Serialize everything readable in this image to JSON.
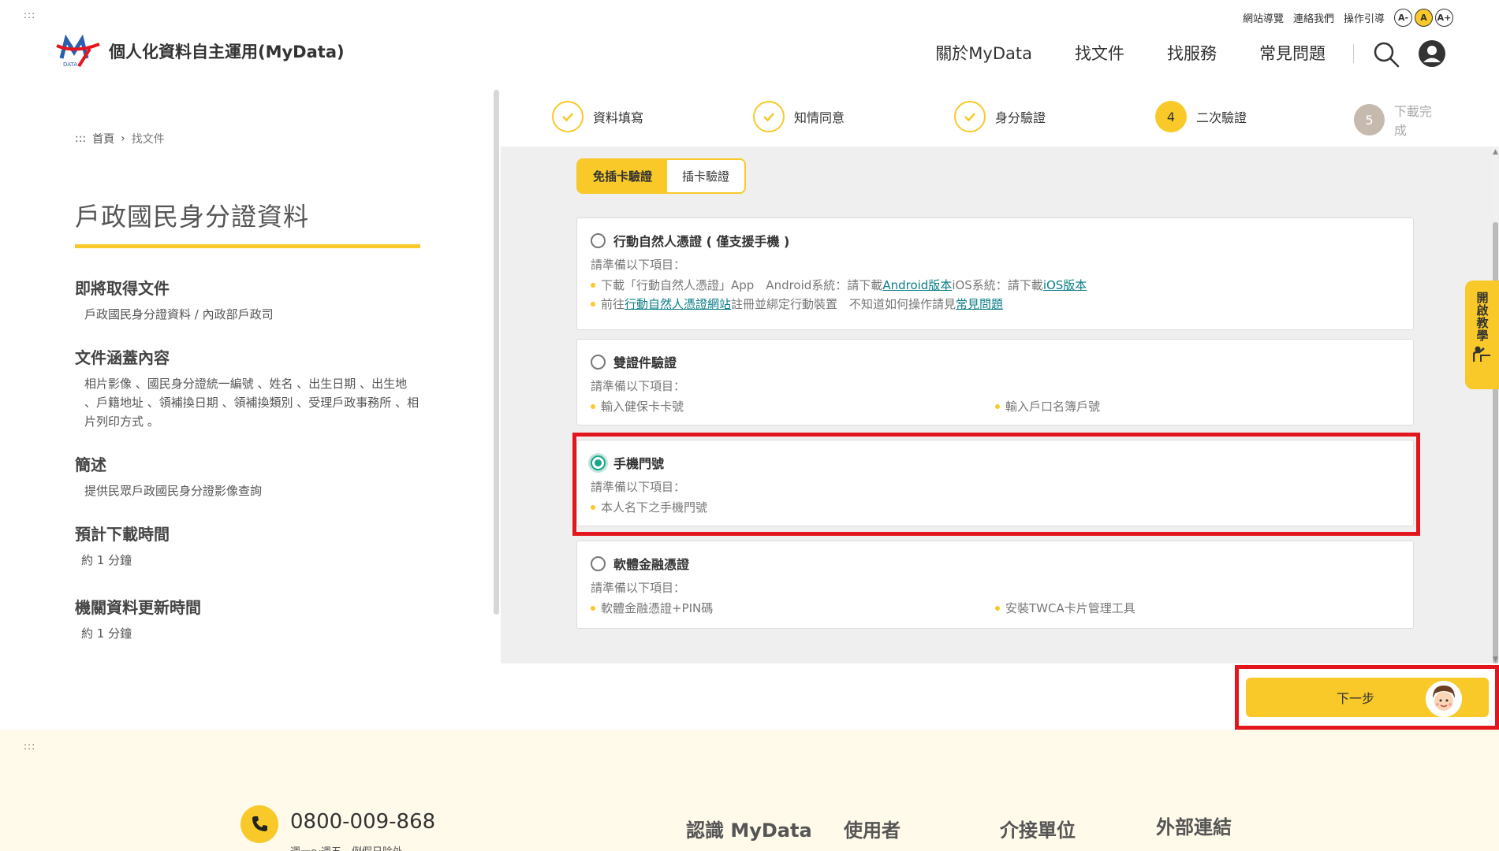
{
  "header": {
    "accesskey_top": ":::",
    "util_links": [
      "網站導覽",
      "連絡我們",
      "操作引導"
    ],
    "font_sizes": [
      "A-",
      "A",
      "A+"
    ],
    "logo_mark": "DATA",
    "site_title": "個人化資料自主運用(MyData)",
    "nav": [
      "關於MyData",
      "找文件",
      "找服務",
      "常見問題"
    ]
  },
  "breadcrumb": {
    "prefix": ":::",
    "home": "首頁",
    "separator": "›",
    "current": "找文件"
  },
  "document": {
    "title": "戶政國民身分證資料",
    "sections": [
      {
        "heading": "即將取得文件",
        "value": "戶政國民身分證資料 / 內政部戶政司"
      },
      {
        "heading": "文件涵蓋內容",
        "value": "相片影像 、國民身分證統一編號 、姓名 、出生日期 、出生地 、戶籍地址 、領補換日期 、領補換類別 、受理戶政事務所 、相片列印方式 。"
      },
      {
        "heading": "簡述",
        "value": "提供民眾戶政國民身分證影像查詢"
      },
      {
        "heading": "預計下載時間",
        "value": "約 1 分鐘"
      },
      {
        "heading": "機關資料更新時間",
        "value": "約 1  分鐘"
      }
    ]
  },
  "steps": [
    {
      "number": "1",
      "label": "資料填寫",
      "state": "done"
    },
    {
      "number": "2",
      "label": "知情同意",
      "state": "done"
    },
    {
      "number": "3",
      "label": "身分驗證",
      "state": "done"
    },
    {
      "number": "4",
      "label": "二次驗證",
      "state": "current"
    },
    {
      "number": "5",
      "label": "下載完成",
      "state": "future"
    }
  ],
  "tabs": [
    "免插卡驗證",
    "插卡驗證"
  ],
  "options": {
    "mobile_cert": {
      "title": "行動自然人憑證 ( 僅支援手機 )",
      "prep": "請準備以下項目：",
      "b1_text": "下載「行動自然人憑證」App　Android系統：請下載 ",
      "b1_link1": "Android版本",
      "b1_mid": "  iOS系統：請下載",
      "b1_link2": "iOS版本",
      "b2_pre": "前往",
      "b2_link1": "行動自然人憑證網站",
      "b2_mid": "註冊並綁定行動裝置　不知道如何操作請見",
      "b2_link2": "常見問題"
    },
    "dual_id": {
      "title": "雙證件驗證",
      "prep": "請準備以下項目：",
      "items": [
        "輸入健保卡卡號",
        "輸入戶口名簿戶號"
      ]
    },
    "mobile_number": {
      "title": "手機門號",
      "prep": "請準備以下項目：",
      "items": [
        "本人名下之手機門號"
      ],
      "selected": true
    },
    "software_cert": {
      "title": "軟體金融憑證",
      "prep": "請準備以下項目：",
      "items": [
        "軟體金融憑證+PIN碼",
        "安裝TWCA卡片管理工具"
      ]
    }
  },
  "tutorial_label": "開啟教學",
  "next_button": "下一步",
  "footer": {
    "accesskey": ":::",
    "phone": "0800-009-868",
    "hours": "週一～週五　例假日除外",
    "columns": [
      "認識 MyData",
      "使用者",
      "介接單位",
      "外部連結"
    ]
  },
  "colors": {
    "accent": "#f8c929",
    "teal": "#1aa58d",
    "highlight": "#e3161e"
  }
}
